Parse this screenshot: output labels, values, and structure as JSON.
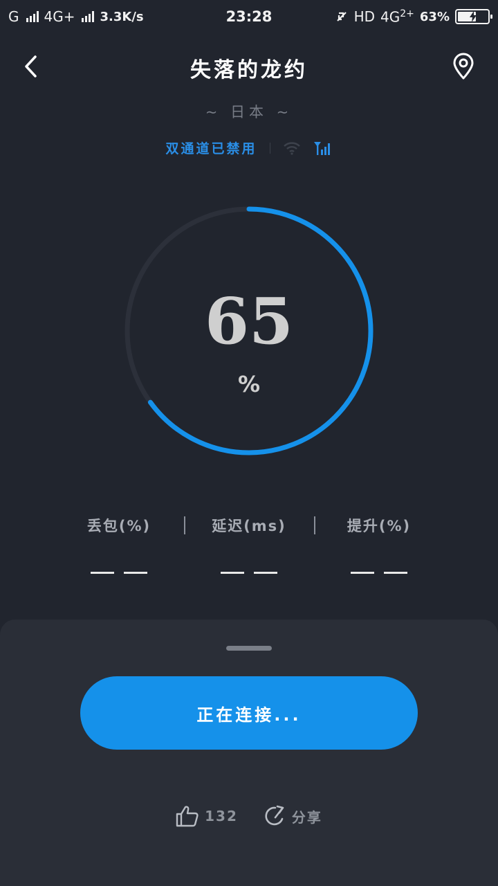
{
  "status_bar": {
    "carrier1": "G",
    "carrier2": "4G+",
    "speed": "3.3K/s",
    "time": "23:28",
    "hd": "HD",
    "network": "4G",
    "network_sub": "2+",
    "battery": "63%"
  },
  "header": {
    "title": "失落的龙约",
    "region": "~ 日本 ~"
  },
  "channel": {
    "status_text": "双通道已禁用",
    "wifi_icon": "wifi-icon",
    "cellular_icon": "cellular-signal-icon"
  },
  "progress": {
    "value": "65",
    "unit": "%",
    "fraction": 0.65,
    "color": "#1591ea",
    "track_color": "#2c303a"
  },
  "stats": {
    "packet_loss_label": "丢包(%)",
    "latency_label": "延迟(ms)",
    "boost_label": "提升(%)"
  },
  "actions": {
    "connect_label": "正在连接...",
    "like_count": "132",
    "share_label": "分享"
  }
}
